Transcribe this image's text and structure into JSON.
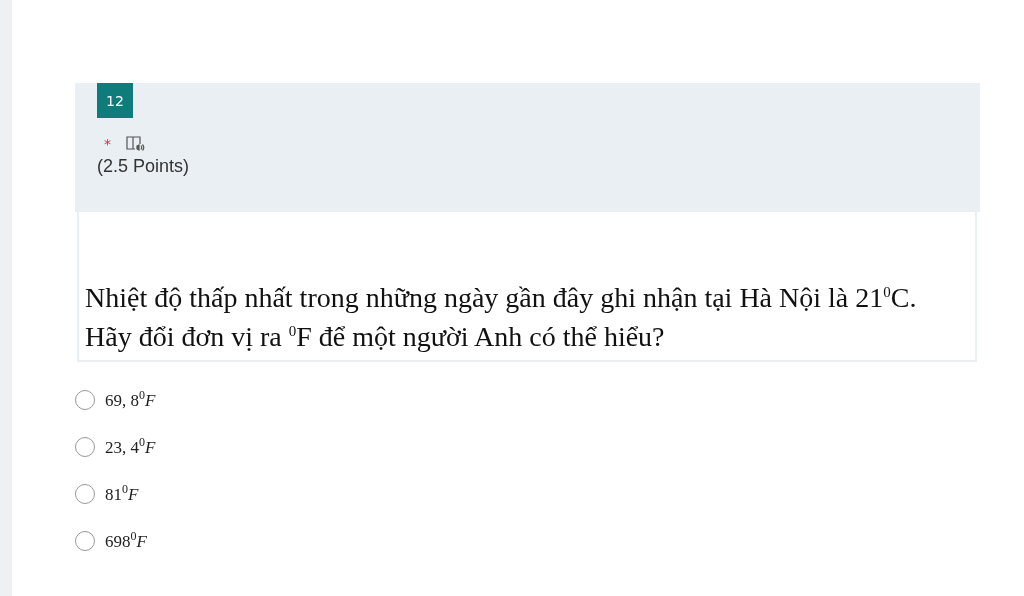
{
  "question": {
    "number": "12",
    "required_mark": "*",
    "points": "(2.5 Points)",
    "text": "Nhiệt độ thấp nhất trong những ngày gần đây ghi nhận tại Hà Nội là 21$^{0}$C. Hãy đổi đơn vị ra $^{0}$F để một người Anh có thể hiểu?"
  },
  "options": [
    {
      "label": "69, 8$^{0}$*F*",
      "selected": false
    },
    {
      "label": "23, 4$^{0}$*F*",
      "selected": false
    },
    {
      "label": "81$^{0}$*F*",
      "selected": false
    },
    {
      "label": "698$^{0}$*F*",
      "selected": false
    }
  ]
}
